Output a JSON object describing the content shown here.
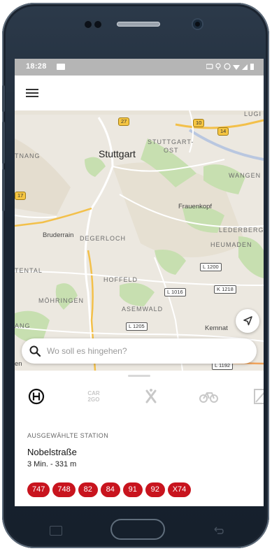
{
  "status_bar": {
    "time": "18:28"
  },
  "map": {
    "city": "Stuttgart",
    "district_labels": [
      "STUTTGART-",
      "OST",
      "DEGERLOCH",
      "HOFFELD",
      "ASEMWALD",
      "MÖHRINGEN",
      "HEUMADEN",
      "LEDERBERG",
      "WANGEN",
      "TNANG",
      "TENTAL",
      "ANG",
      "LUGI"
    ],
    "places": [
      "Frauenkopf",
      "Bruderrain",
      "Kemnat",
      "en"
    ],
    "road_badges": [
      "27",
      "10",
      "14",
      "17",
      "L 1200",
      "L 1016",
      "K 1218",
      "L 1205",
      "L 1192"
    ]
  },
  "search": {
    "placeholder": "Wo soll es hingehen?"
  },
  "tabs": {
    "car_label_top": "CAR",
    "car_label_bottom": "2GO"
  },
  "station": {
    "section_label": "AUSGEWÄHLTE STATION",
    "name": "Nobelstraße",
    "meta": "3 Min. - 331 m",
    "lines": [
      "747",
      "748",
      "82",
      "84",
      "91",
      "92",
      "X74"
    ]
  },
  "colors": {
    "line_chip": "#c8141e",
    "map_bg": "#ece8e0",
    "park_green": "#c7dfb0",
    "status_bar": "#b5b5b5"
  },
  "icons": [
    "menu-icon",
    "locate-arrow-icon",
    "search-icon",
    "haltestelle-icon",
    "carsharing-icon",
    "scooter-icon",
    "bike-icon",
    "ticket-icon"
  ]
}
